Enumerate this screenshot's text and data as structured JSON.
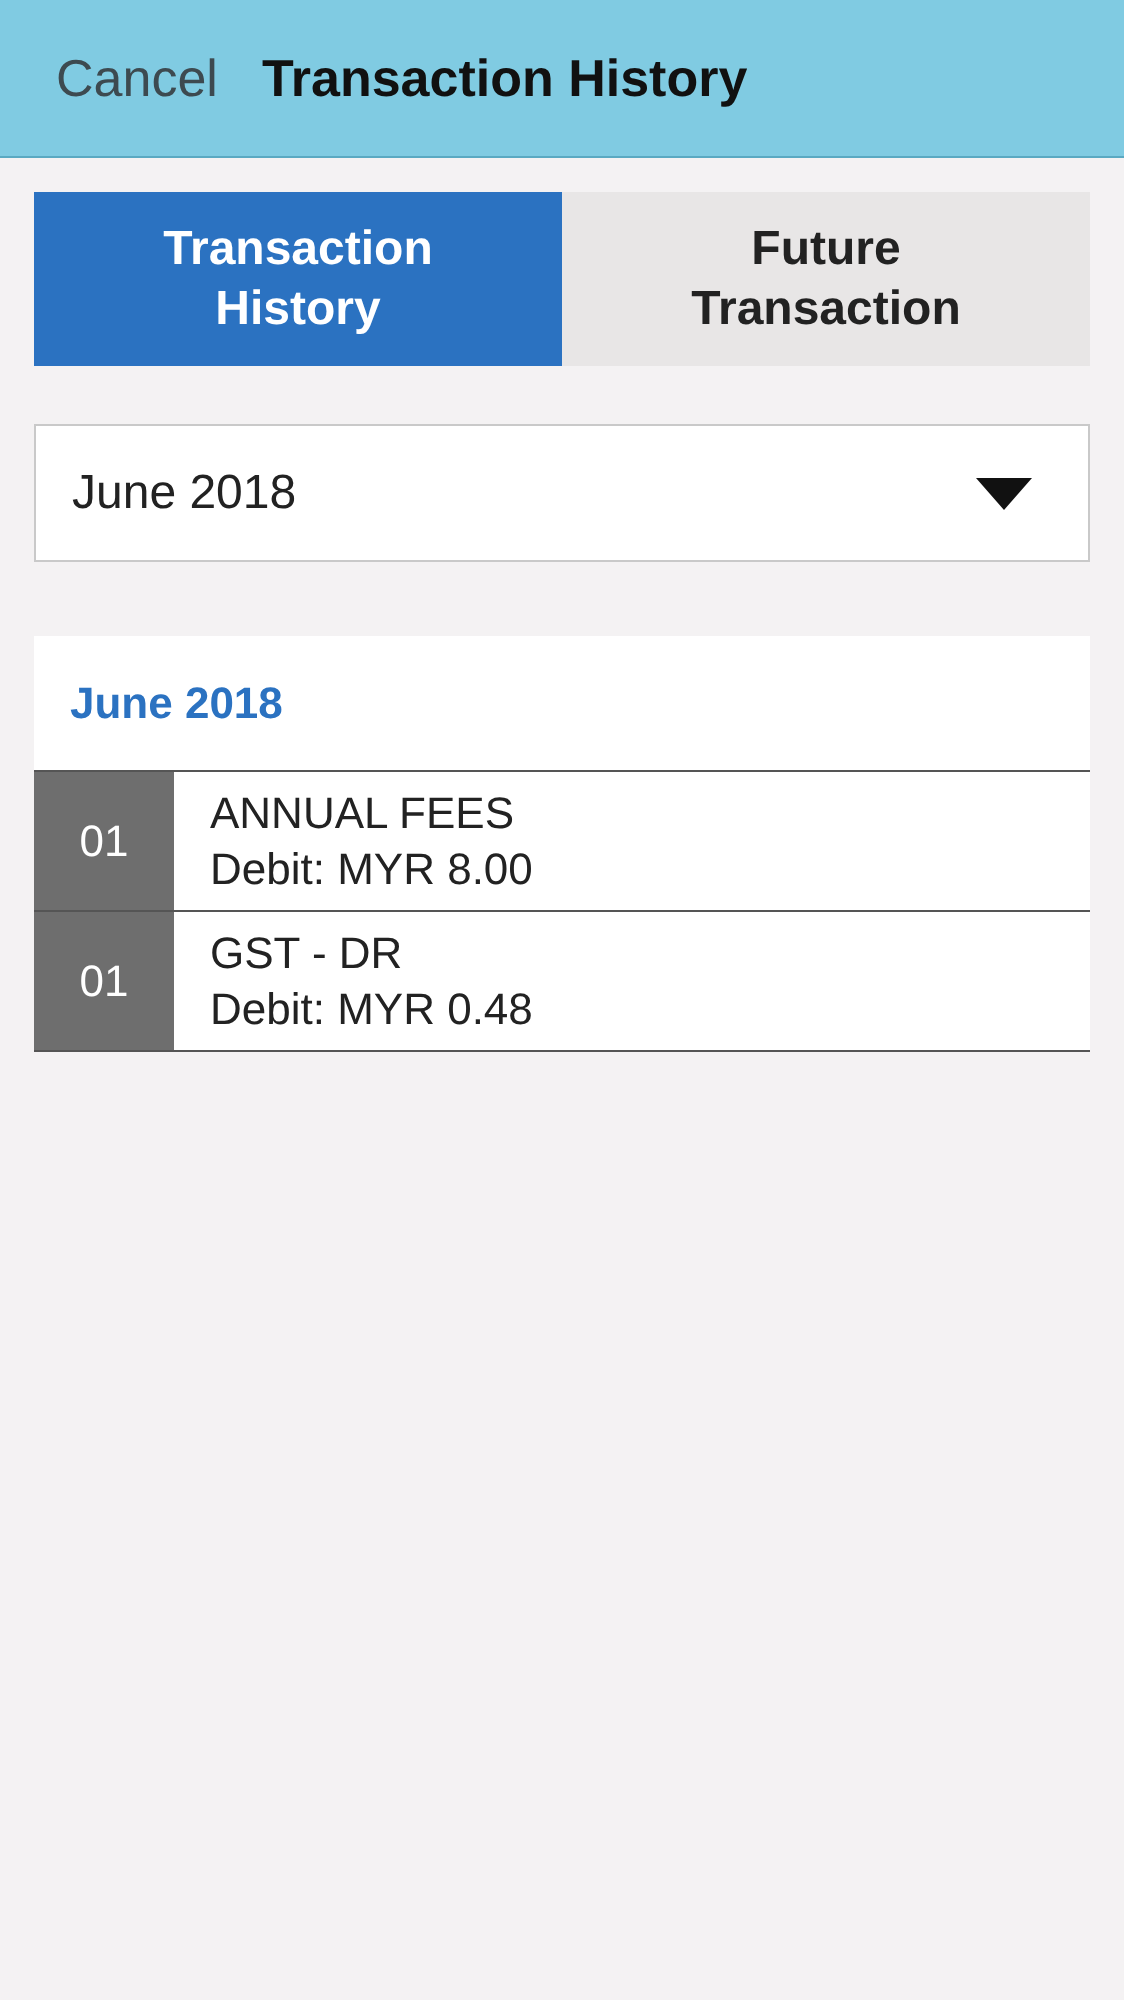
{
  "header": {
    "cancel": "Cancel",
    "title": "Transaction History"
  },
  "tabs": [
    {
      "label": "Transaction History",
      "selected": true
    },
    {
      "label": "Future Transaction",
      "selected": false
    }
  ],
  "month_picker": {
    "value": "June 2018"
  },
  "section": {
    "title": "June 2018",
    "rows": [
      {
        "day": "01",
        "description": "ANNUAL FEES",
        "amount": "Debit: MYR 8.00"
      },
      {
        "day": "01",
        "description": "GST - DR",
        "amount": "Debit: MYR 0.48"
      }
    ]
  }
}
